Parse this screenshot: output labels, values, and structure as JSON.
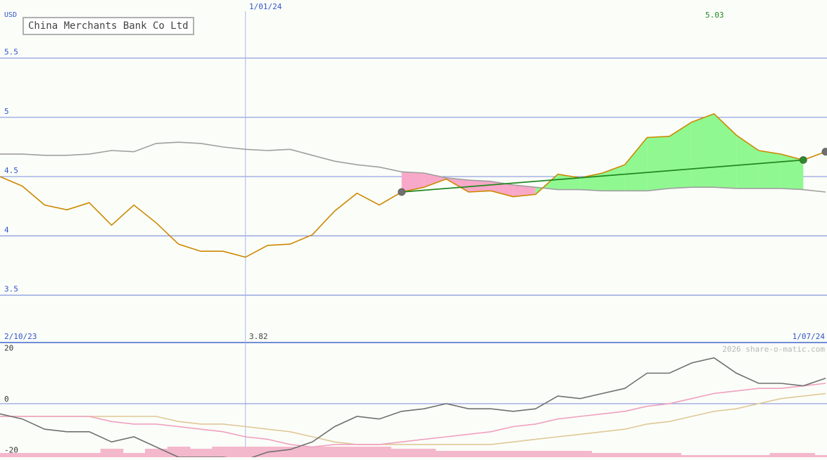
{
  "chart_data": [
    {
      "type": "line",
      "title": "China Merchants Bank Co Ltd",
      "ylabel": "USD",
      "x_start_label": "2/10/23",
      "x_end_label": "1/07/24",
      "year_marker_label": "1/01/24",
      "max_label": "5.03",
      "min_label": "3.82",
      "watermark": "2026 share-o-matic.com",
      "ylim": [
        3.1,
        5.99
      ],
      "yticks": [
        {
          "value": 5.5,
          "label": "5.5"
        },
        {
          "value": 5.0,
          "label": "5"
        },
        {
          "value": 4.5,
          "label": "4.5"
        },
        {
          "value": 4.0,
          "label": "4"
        },
        {
          "value": 3.5,
          "label": "3.5"
        }
      ],
      "grid": true,
      "colors": {
        "price": "#cc8800",
        "average": "#a0a0a0",
        "trend": "#228822",
        "gain_fill": "#90f890",
        "loss_fill": "#f8a8c8",
        "grid": "#8898e0",
        "axis_text": "#3355cc",
        "max_text": "#228822"
      },
      "series": [
        {
          "key": "price",
          "values": [
            4.5,
            4.42,
            4.26,
            4.22,
            4.28,
            4.09,
            4.26,
            4.11,
            3.93,
            3.87,
            3.87,
            3.82,
            3.92,
            3.93,
            4.01,
            4.21,
            4.36,
            4.26,
            4.37,
            4.41,
            4.48,
            4.37,
            4.38,
            4.33,
            4.35,
            4.52,
            4.49,
            4.53,
            4.6,
            4.83,
            4.84,
            4.96,
            5.03,
            4.85,
            4.72,
            4.69,
            4.64,
            4.71
          ]
        },
        {
          "key": "average",
          "values": [
            4.69,
            4.69,
            4.68,
            4.68,
            4.69,
            4.72,
            4.71,
            4.78,
            4.79,
            4.78,
            4.75,
            4.73,
            4.72,
            4.73,
            4.68,
            4.63,
            4.6,
            4.58,
            4.54,
            4.53,
            4.49,
            4.47,
            4.46,
            4.43,
            4.41,
            4.39,
            4.39,
            4.38,
            4.38,
            4.38,
            4.4,
            4.41,
            4.41,
            4.4,
            4.4,
            4.4,
            4.39,
            4.37
          ]
        }
      ],
      "trend": {
        "from_index": 18,
        "to_index": 36
      },
      "markers": [
        {
          "index": 18,
          "color": "#707070"
        },
        {
          "index": 36,
          "color": "#2a8a2a"
        },
        {
          "index": 37,
          "color": "#707070"
        }
      ]
    },
    {
      "type": "line",
      "ylim": [
        -21,
        24
      ],
      "yticks": [
        {
          "value": 20,
          "label": "20"
        },
        {
          "value": 0,
          "label": "0"
        },
        {
          "value": -20,
          "label": "-20"
        }
      ],
      "colors": {
        "momentum": "#707070",
        "signal_fast": "#f0a0c0",
        "signal_slow": "#e0c898",
        "volume": "#f4b8cc"
      },
      "series": [
        {
          "key": "momentum",
          "values": [
            -4,
            -6,
            -10,
            -11,
            -11,
            -15,
            -13,
            -17,
            -21,
            -21,
            -21,
            -22,
            -19,
            -18,
            -15,
            -9,
            -5,
            -6,
            -3,
            -2,
            0,
            -2,
            -2,
            -3,
            -2,
            3,
            2,
            4,
            6,
            12,
            12,
            16,
            18,
            12,
            8,
            8,
            7,
            10
          ]
        },
        {
          "key": "signal_fast",
          "values": [
            -5,
            -5,
            -5,
            -5,
            -5,
            -7,
            -8,
            -8,
            -9,
            -10,
            -11,
            -13,
            -14,
            -16,
            -17,
            -16,
            -16,
            -16,
            -15,
            -14,
            -13,
            -12,
            -11,
            -9,
            -8,
            -6,
            -5,
            -4,
            -3,
            -1,
            0,
            2,
            4,
            5,
            6,
            6,
            7,
            8
          ]
        },
        {
          "key": "signal_slow",
          "values": [
            -5,
            -5,
            -5,
            -5,
            -5,
            -5,
            -5,
            -5,
            -7,
            -8,
            -8,
            -9,
            -10,
            -11,
            -13,
            -15,
            -16,
            -16,
            -16,
            -16,
            -16,
            -16,
            -16,
            -15,
            -14,
            -13,
            -12,
            -11,
            -10,
            -8,
            -7,
            -5,
            -3,
            -2,
            0,
            2,
            3,
            4
          ]
        },
        {
          "key": "volume",
          "values": [
            2,
            2,
            2,
            2,
            2,
            4,
            2,
            4,
            5,
            4,
            5,
            5,
            5,
            5,
            5,
            5,
            5,
            5,
            4,
            4,
            3,
            3,
            3,
            3,
            3,
            3,
            3,
            2,
            2,
            2,
            2,
            1,
            1,
            1,
            1,
            2,
            2,
            1
          ]
        }
      ]
    }
  ]
}
